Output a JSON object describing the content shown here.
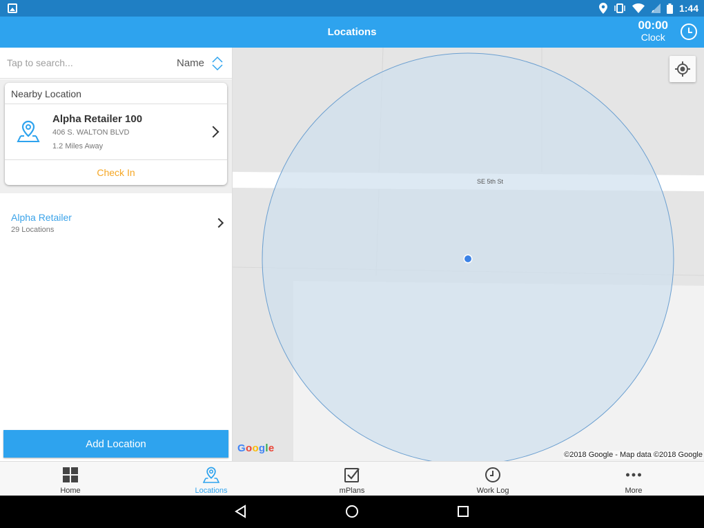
{
  "status_bar": {
    "time": "1:44"
  },
  "app_bar": {
    "title": "Locations",
    "clock_time": "00:00",
    "clock_label": "Clock"
  },
  "search": {
    "placeholder": "Tap to search...",
    "sort_label": "Name"
  },
  "nearby": {
    "header": "Nearby Location",
    "name": "Alpha Retailer 100",
    "address": "406 S. WALTON BLVD",
    "distance": "1.2 Miles Away",
    "check_in_label": "Check In"
  },
  "retailers": [
    {
      "name": "Alpha Retailer",
      "count": "29 Locations"
    }
  ],
  "add_location_label": "Add Location",
  "map": {
    "street_label": "SE 5th St",
    "logo": "Google",
    "copyright": "©2018 Google - Map data ©2018 Google"
  },
  "tabs": [
    {
      "label": "Home",
      "icon": "grid-icon"
    },
    {
      "label": "Locations",
      "icon": "location-pin-icon",
      "active": true
    },
    {
      "label": "mPlans",
      "icon": "checkbox-icon"
    },
    {
      "label": "Work Log",
      "icon": "clock-icon"
    },
    {
      "label": "More",
      "icon": "more-dots-icon"
    }
  ],
  "colors": {
    "accent": "#2ea3ee",
    "status_bar": "#1f7fc4",
    "check_in": "#f5a623",
    "radius_fill": "#cfe0ee"
  }
}
